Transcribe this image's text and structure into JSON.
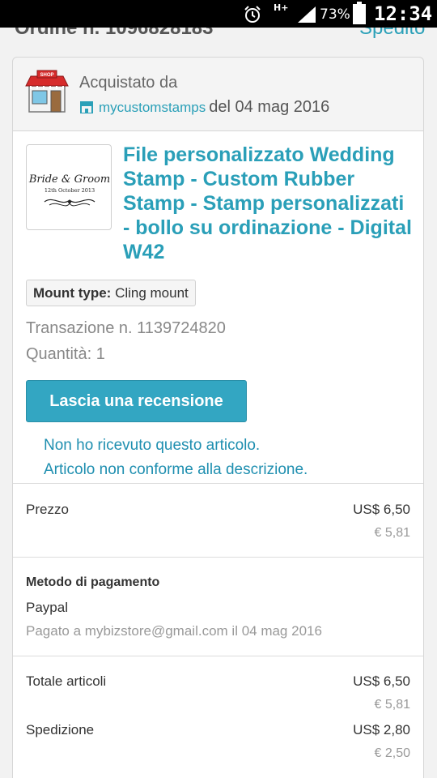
{
  "status_bar": {
    "network": "H+",
    "battery_percent": "73%",
    "time": "12:34",
    "battery_level": 0.73,
    "icons": [
      "alarm-icon",
      "signal-icon",
      "battery-icon"
    ]
  },
  "header": {
    "order_title_cropped": "Ordine n. 1096828183",
    "status_cropped": "Spedito"
  },
  "seller": {
    "purchased_by_label": "Acquistato da",
    "shop_name": "mycustomstamps",
    "date_text": "del 04 mag 2016",
    "logo_text": "SHOP"
  },
  "item": {
    "title": "File personalizzato Wedding Stamp - Custom Rubber Stamp - Stamp personalizzati - bollo su ordinazione - Digital W42",
    "thumbnail_line1": "Bride & Groom",
    "thumbnail_line2": "12th October 2013",
    "variation_key": "Mount type:",
    "variation_value": "Cling mount",
    "transaction": "Transazione n. 1139724820",
    "quantity": "Quantità: 1"
  },
  "actions": {
    "review_button": "Lascia una recensione",
    "not_received": "Non ho ricevuto questo articolo.",
    "not_as_described": "Articolo non conforme alla descrizione."
  },
  "price": {
    "label": "Prezzo",
    "usd": "US$ 6,50",
    "eur": "€ 5,81"
  },
  "payment": {
    "title": "Metodo di pagamento",
    "method": "Paypal",
    "detail": "Pagato a mybizstore@gmail.com il 04 mag 2016"
  },
  "totals": {
    "items_label": "Totale articoli",
    "items_usd": "US$ 6,50",
    "items_eur": "€ 5,81",
    "shipping_label": "Spedizione",
    "shipping_usd": "US$ 2,80",
    "shipping_eur": "€ 2,50"
  },
  "colors": {
    "accent": "#2a9fb8",
    "button": "#33a6c2",
    "link": "#1f8fb0"
  }
}
